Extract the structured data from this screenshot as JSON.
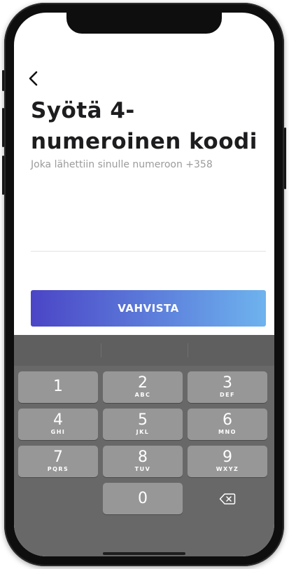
{
  "header": {
    "back_icon": "chevron-left-icon",
    "title": "Syötä 4-numeroinen koodi",
    "subtitle": "Joka lähettiin sinulle numeroon +358"
  },
  "code_field": {
    "value": "",
    "placeholder": ""
  },
  "confirm_button": {
    "label": "VAHVISTA"
  },
  "keypad": {
    "keys": [
      {
        "digit": "1",
        "letters": ""
      },
      {
        "digit": "2",
        "letters": "ABC"
      },
      {
        "digit": "3",
        "letters": "DEF"
      },
      {
        "digit": "4",
        "letters": "GHI"
      },
      {
        "digit": "5",
        "letters": "JKL"
      },
      {
        "digit": "6",
        "letters": "MNO"
      },
      {
        "digit": "7",
        "letters": "PQRS"
      },
      {
        "digit": "8",
        "letters": "TUV"
      },
      {
        "digit": "9",
        "letters": "WXYZ"
      },
      {
        "digit": "0",
        "letters": ""
      }
    ],
    "delete_icon": "backspace-icon"
  },
  "colors": {
    "button_gradient_start": "#4b45c6",
    "button_gradient_end": "#6eb3ee",
    "keyboard_background": "#686868",
    "key_background": "#979797",
    "title_text": "#1d1d1f",
    "subtitle_text": "#9b9b9b"
  }
}
